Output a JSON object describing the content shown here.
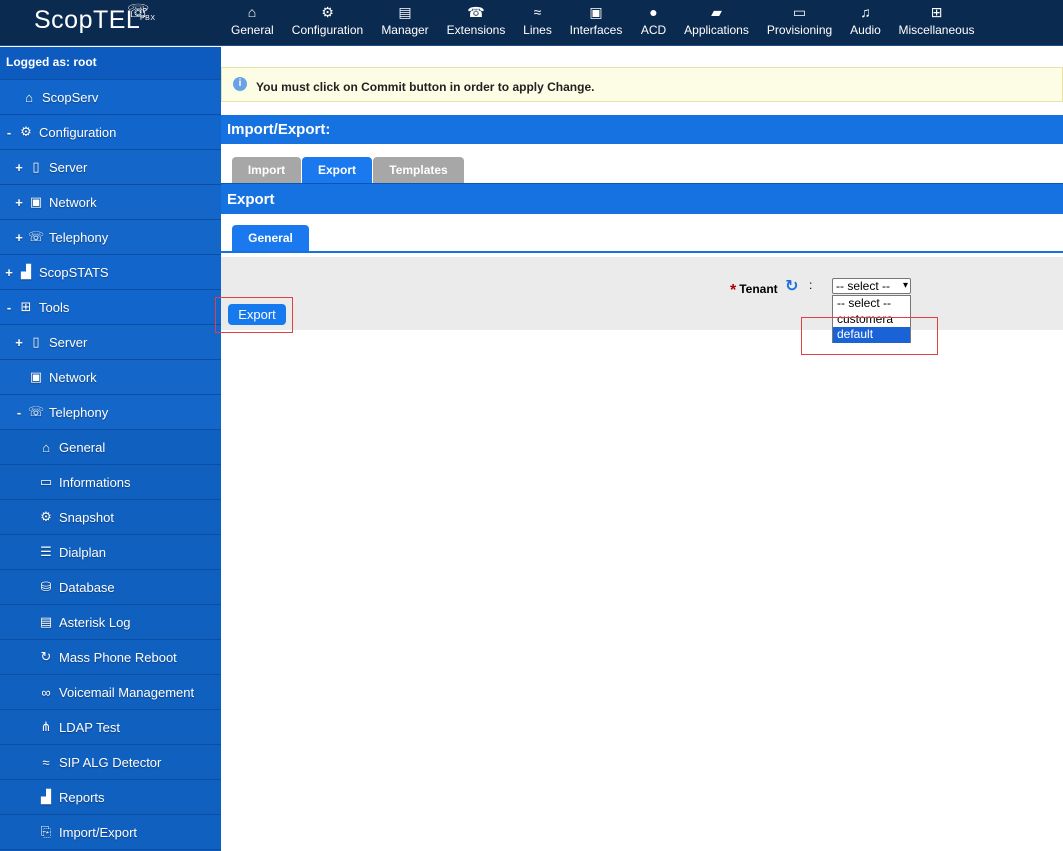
{
  "app": {
    "logo": "ScopTEL",
    "logo_sub": "IP PBX"
  },
  "nav": [
    {
      "label": "General",
      "icon": "home-icon"
    },
    {
      "label": "Configuration",
      "icon": "gear-icon"
    },
    {
      "label": "Manager",
      "icon": "list-icon"
    },
    {
      "label": "Extensions",
      "icon": "phone-icon"
    },
    {
      "label": "Lines",
      "icon": "lines-icon"
    },
    {
      "label": "Interfaces",
      "icon": "interfaces-icon"
    },
    {
      "label": "ACD",
      "icon": "user-icon"
    },
    {
      "label": "Applications",
      "icon": "folder-icon"
    },
    {
      "label": "Provisioning",
      "icon": "provisioning-icon"
    },
    {
      "label": "Audio",
      "icon": "music-icon"
    },
    {
      "label": "Miscellaneous",
      "icon": "grid-icon"
    }
  ],
  "sidebar": {
    "logged_as": "Logged as: root",
    "items": [
      {
        "label": "ScopServ",
        "toggle": "",
        "icon": "home-icon"
      },
      {
        "label": "Configuration",
        "toggle": "-",
        "icon": "gear-icon"
      },
      {
        "label": "Server",
        "toggle": "+",
        "icon": "server-icon"
      },
      {
        "label": "Network",
        "toggle": "+",
        "icon": "network-icon"
      },
      {
        "label": "Telephony",
        "toggle": "+",
        "icon": "telephony-icon"
      },
      {
        "label": "ScopSTATS",
        "toggle": "+",
        "icon": "stats-icon"
      },
      {
        "label": "Tools",
        "toggle": "-",
        "icon": "tools-icon"
      },
      {
        "label": "Server",
        "toggle": "+",
        "icon": "server-icon"
      },
      {
        "label": "Network",
        "toggle": "",
        "icon": "network-icon"
      },
      {
        "label": "Telephony",
        "toggle": "-",
        "icon": "telephony-icon"
      },
      {
        "label": "General",
        "toggle": "",
        "icon": "home-icon"
      },
      {
        "label": "Informations",
        "toggle": "",
        "icon": "monitor-icon"
      },
      {
        "label": "Snapshot",
        "toggle": "",
        "icon": "gear-icon"
      },
      {
        "label": "Dialplan",
        "toggle": "",
        "icon": "dialplan-icon"
      },
      {
        "label": "Database",
        "toggle": "",
        "icon": "database-icon"
      },
      {
        "label": "Asterisk Log",
        "toggle": "",
        "icon": "document-icon"
      },
      {
        "label": "Mass Phone Reboot",
        "toggle": "",
        "icon": "reboot-icon"
      },
      {
        "label": "Voicemail Management",
        "toggle": "",
        "icon": "voicemail-icon"
      },
      {
        "label": "LDAP Test",
        "toggle": "",
        "icon": "hierarchy-icon"
      },
      {
        "label": "SIP ALG Detector",
        "toggle": "",
        "icon": "sip-icon"
      },
      {
        "label": "Reports",
        "toggle": "",
        "icon": "chart-icon"
      },
      {
        "label": "Import/Export",
        "toggle": "",
        "icon": "import-export-icon"
      }
    ]
  },
  "main": {
    "notice": "You must click on Commit button in order to apply Change.",
    "title": "Import/Export:",
    "tabs": [
      "Import",
      "Export",
      "Templates"
    ],
    "active_tab": "Export",
    "section_title": "Export",
    "subtabs": [
      "General"
    ],
    "export_button": "Export",
    "form": {
      "tenant_label": "Tenant",
      "required_mark": "*",
      "colon": ":",
      "selected": "-- select --",
      "options": [
        "-- select --",
        "customera",
        "default"
      ],
      "highlighted_option": "default"
    }
  },
  "colors": {
    "topbar": "#0b2a4f",
    "sidebar": "#0d5bbf",
    "accent": "#1672e0",
    "tab_inactive": "#a7a7a7",
    "notice_bg": "#fdfde5",
    "annotation_red": "#e04040"
  }
}
